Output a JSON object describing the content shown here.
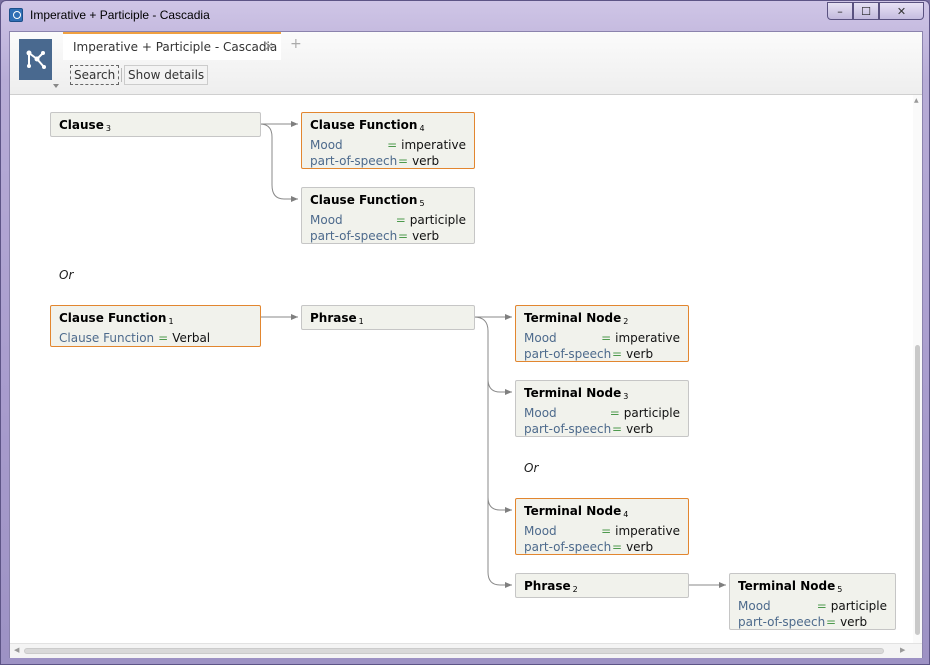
{
  "window": {
    "title": "Imperative + Participle - Cascadia",
    "controls": {
      "minimize_icon": "minimize-icon",
      "maximize_icon": "maximize-icon",
      "close_icon": "close-icon"
    }
  },
  "app": {
    "logo_icon": "tree-graph-icon"
  },
  "tabs": [
    {
      "label": "Imperative + Participle - Cascadia",
      "close": "×",
      "active": true
    }
  ],
  "tab_add": "+",
  "toolbar": {
    "search_label": "Search",
    "details_label": "Show details"
  },
  "query": {
    "or_label": "Or",
    "nodes": {
      "clause3": {
        "title": "Clause",
        "index": "3",
        "attrs": []
      },
      "cf4": {
        "title": "Clause Function",
        "index": "4",
        "attrs": [
          {
            "key": "Mood",
            "eq": "=",
            "val": "imperative"
          },
          {
            "key": "part-of-speech",
            "eq": "=",
            "val": "verb"
          }
        ]
      },
      "cf5": {
        "title": "Clause Function",
        "index": "5",
        "attrs": [
          {
            "key": "Mood",
            "eq": "=",
            "val": "participle"
          },
          {
            "key": "part-of-speech",
            "eq": "=",
            "val": "verb"
          }
        ]
      },
      "cf1": {
        "title": "Clause Function",
        "index": "1",
        "attrs": [
          {
            "key": "Clause Function",
            "eq": "=",
            "val": "Verbal"
          }
        ]
      },
      "phrase1": {
        "title": "Phrase",
        "index": "1",
        "attrs": []
      },
      "tn2": {
        "title": "Terminal Node",
        "index": "2",
        "attrs": [
          {
            "key": "Mood",
            "eq": "=",
            "val": "imperative"
          },
          {
            "key": "part-of-speech",
            "eq": "=",
            "val": "verb"
          }
        ]
      },
      "tn3": {
        "title": "Terminal Node",
        "index": "3",
        "attrs": [
          {
            "key": "Mood",
            "eq": "=",
            "val": "participle"
          },
          {
            "key": "part-of-speech",
            "eq": "=",
            "val": "verb"
          }
        ]
      },
      "tn4": {
        "title": "Terminal Node",
        "index": "4",
        "attrs": [
          {
            "key": "Mood",
            "eq": "=",
            "val": "imperative"
          },
          {
            "key": "part-of-speech",
            "eq": "=",
            "val": "verb"
          }
        ]
      },
      "phrase2": {
        "title": "Phrase",
        "index": "2",
        "attrs": []
      },
      "tn5": {
        "title": "Terminal Node",
        "index": "5",
        "attrs": [
          {
            "key": "Mood",
            "eq": "=",
            "val": "participle"
          },
          {
            "key": "part-of-speech",
            "eq": "=",
            "val": "verb"
          }
        ]
      }
    }
  },
  "colors": {
    "selected_border": "#e2862f",
    "node_bg": "#f1f2ec",
    "attr_key": "#4d6a8c",
    "attr_eq": "#4d9a4d",
    "logo_bg": "#49698f"
  }
}
